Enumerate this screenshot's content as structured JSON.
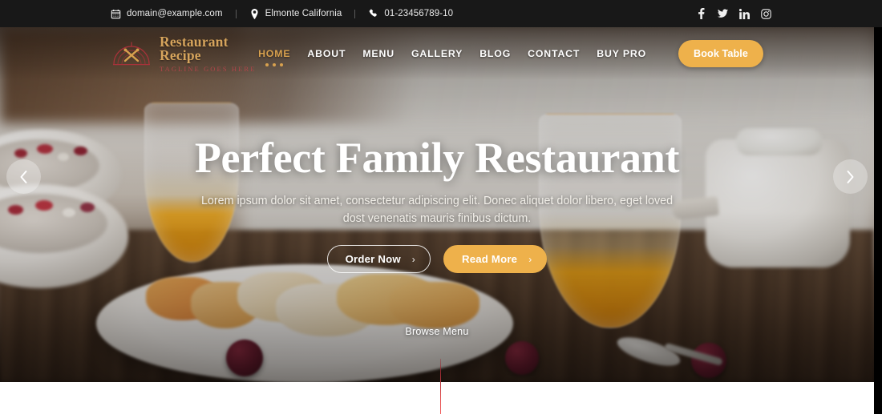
{
  "topbar": {
    "email": "domain@example.com",
    "location": "Elmonte California",
    "phone": "01-23456789-10",
    "icons": {
      "email": "calendar-icon",
      "location": "map-pin-icon",
      "phone": "phone-icon"
    },
    "social": [
      {
        "name": "facebook-icon",
        "label": "Facebook"
      },
      {
        "name": "twitter-icon",
        "label": "Twitter"
      },
      {
        "name": "linkedin-icon",
        "label": "LinkedIn"
      },
      {
        "name": "instagram-icon",
        "label": "Instagram"
      }
    ],
    "background": "#181818"
  },
  "brand": {
    "name": "Restaurant Recipe",
    "tagline": "Tagline Goes Here",
    "logo_icon": "dome-crossed-utensils-logo",
    "name_color": "#d6a45c",
    "tagline_color": "#b1454a"
  },
  "nav": {
    "items": [
      {
        "label": "HOME",
        "active": true
      },
      {
        "label": "ABOUT",
        "active": false
      },
      {
        "label": "MENU",
        "active": false
      },
      {
        "label": "GALLERY",
        "active": false
      },
      {
        "label": "BLOG",
        "active": false
      },
      {
        "label": "CONTACT",
        "active": false
      },
      {
        "label": "BUY PRO",
        "active": false
      }
    ],
    "book_button": "Book Table",
    "accent": "#eeb14b",
    "active_color": "#d8a14e"
  },
  "hero": {
    "title": "Perfect Family Restaurant",
    "subtitle": "Lorem ipsum dolor sit amet, consectetur adipiscing elit. Donec aliquet dolor libero, eget loved dost venenatis mauris finibus dictum.",
    "primary_button": "Order Now",
    "secondary_button": "Read More",
    "chevron": "›",
    "browse_label": "Browse Menu",
    "prev_icon": "chevron-left-icon",
    "next_icon": "chevron-right-icon",
    "scroll_line_color": "#e24b4b"
  }
}
